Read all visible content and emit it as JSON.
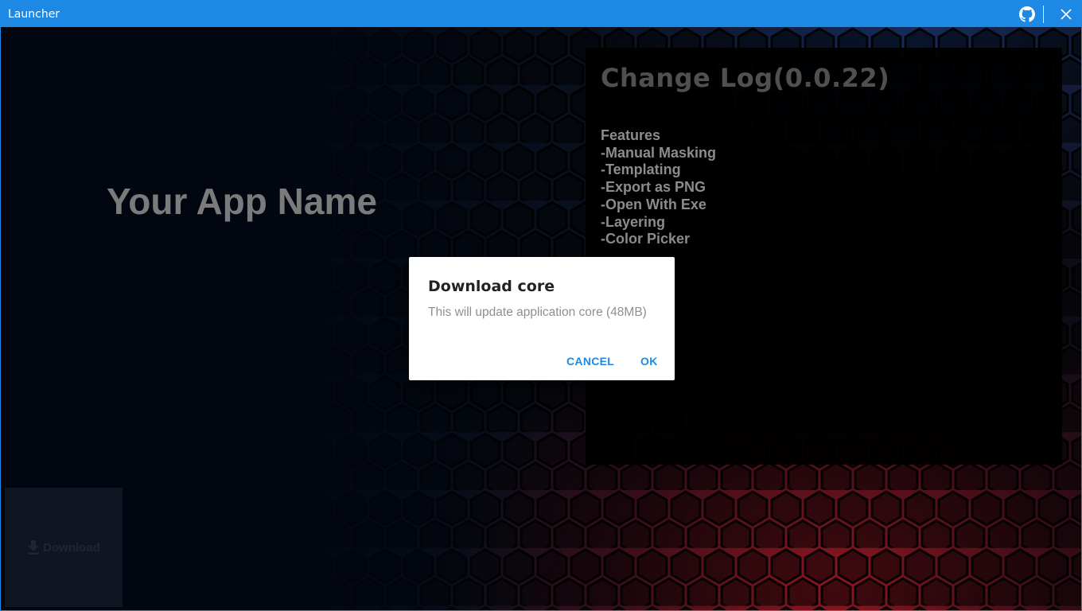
{
  "window": {
    "title": "Launcher"
  },
  "titlebar": {
    "github_icon": "github-icon",
    "close_icon": "close-icon"
  },
  "main": {
    "app_name": "Your App Name",
    "download": {
      "label": "Download",
      "icon": "download-icon"
    }
  },
  "changelog": {
    "title": "Change Log(0.0.22)",
    "lines": [
      "Features",
      "-Manual Masking",
      "-Templating",
      "-Export as PNG",
      "-Open With Exe",
      "-Layering",
      "-Color Picker"
    ]
  },
  "dialog": {
    "title": "Download core",
    "message": "This will update application core (48MB)",
    "cancel_label": "CANCEL",
    "ok_label": "OK"
  },
  "colors": {
    "accent": "#1e88e5",
    "background": "#0a0d16"
  }
}
